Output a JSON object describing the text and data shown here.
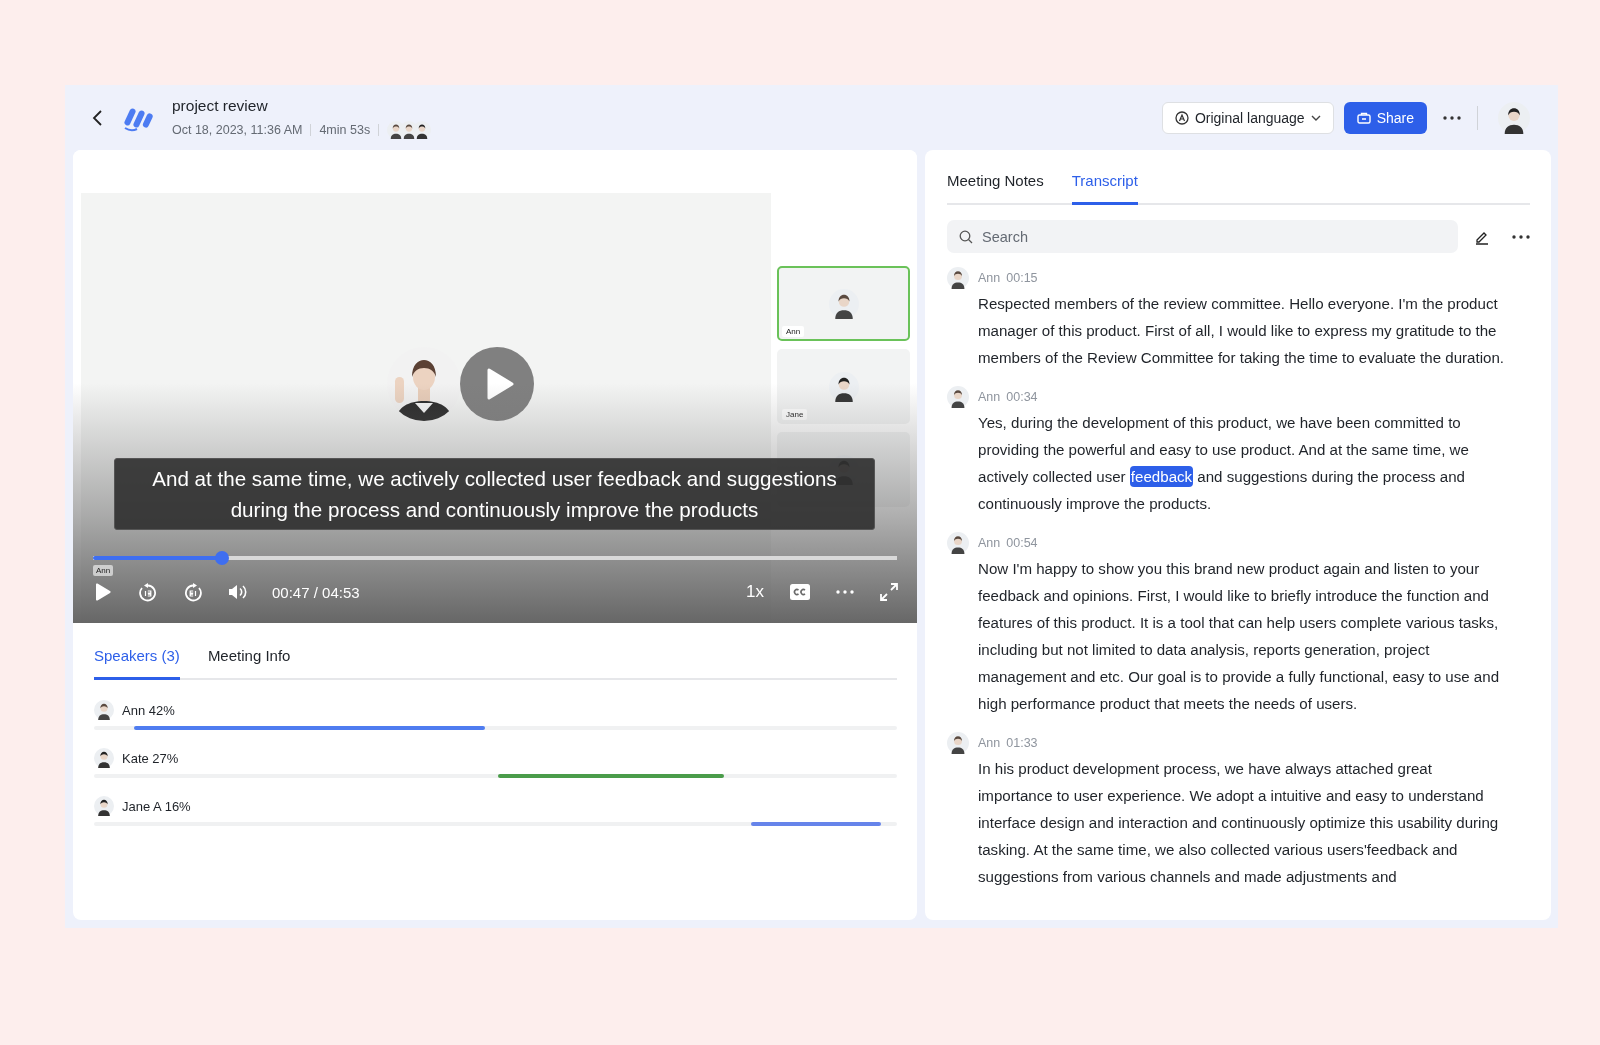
{
  "header": {
    "title": "project review",
    "date": "Oct 18, 2023, 11:36 AM",
    "duration": "4min 53s",
    "language_button": "Original language",
    "share_button": "Share"
  },
  "video": {
    "subtitle": "And at the same time, we actively collected user feedback and suggestions during the process and continuously improve the products",
    "progress_label": "Ann",
    "level": 0.16,
    "time": "00:47 / 04:53",
    "speed": "1x",
    "thumbnails": [
      {
        "label": "Ann",
        "selected": true
      },
      {
        "label": "Jane",
        "selected": false
      },
      {
        "selected": false
      }
    ]
  },
  "speaker_tabs": [
    {
      "label": "Speakers (3)",
      "selected": true
    },
    {
      "label": "Meeting Info",
      "selected": false
    }
  ],
  "speakers": [
    {
      "name": "Ann 42%",
      "color": "#4f7cf0"
    },
    {
      "name": "Kate 27%",
      "color": "#4a9c4a"
    },
    {
      "name": "Jane A 16%",
      "color": "#6684ea"
    }
  ],
  "transcript_tabs": [
    {
      "label": "Meeting Notes",
      "selected": false
    },
    {
      "label": "Transcript",
      "selected": true
    }
  ],
  "search": {
    "placeholder": "Search"
  },
  "entries": [
    {
      "speaker": "Ann",
      "time": "00:15",
      "segments": [
        {
          "text": "Respected members of the review committee. Hello everyone. I'm the product manager of this product. First of all, I would like to express my gratitude to the members of the Review Committee for taking the time to evaluate the duration.",
          "highlighted": false
        }
      ]
    },
    {
      "speaker": "Ann",
      "time": "00:34",
      "segments": [
        {
          "text": "Yes, during the development of this product, we have been committed to providing the powerful and easy to use product. And at the same time, we actively collected user ",
          "highlighted": false
        },
        {
          "text": "feedback",
          "highlighted": true
        },
        {
          "text": " and suggestions during the process and continuously improve the products.",
          "highlighted": false
        }
      ]
    },
    {
      "speaker": "Ann",
      "time": "00:54",
      "segments": [
        {
          "text": "Now I'm happy to show you this brand new product again and listen to your feedback and opinions. First, I would like to briefly introduce the function and features of this product. It is a tool that can help users complete various tasks, including but not limited to data analysis, reports generation, project management and etc. Our goal is to provide a fully functional, easy to use and high performance product that meets the needs of users.",
          "highlighted": false
        }
      ]
    },
    {
      "speaker": "Ann",
      "time": "01:33",
      "segments": [
        {
          "text": "In his product development process, we have always attached great importance to user experience. We adopt a intuitive and easy to understand interface design and interaction and continuously optimize this usability during tasking. At the same time, we also collected various users'feedback and suggestions from various channels and made adjustments and",
          "highlighted": false
        }
      ]
    }
  ]
}
